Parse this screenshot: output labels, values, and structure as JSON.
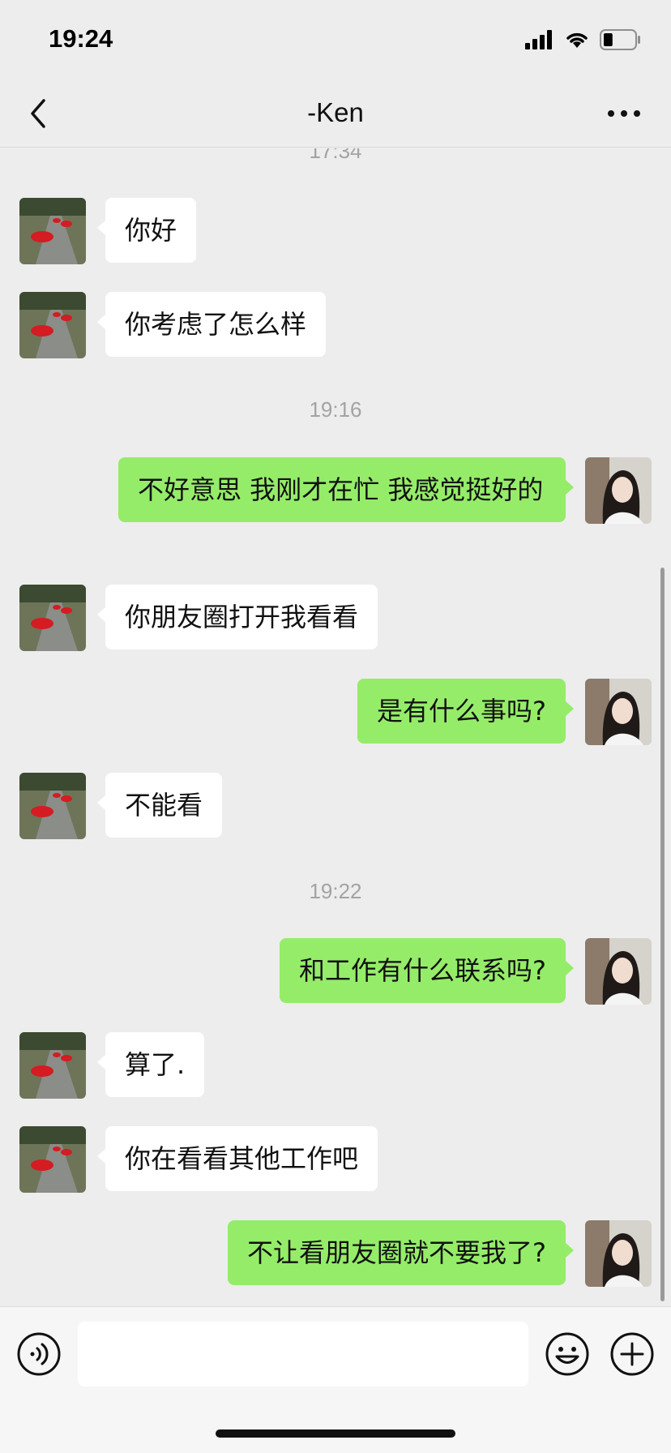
{
  "status_bar": {
    "time": "19:24",
    "battery_level": 0.3
  },
  "header": {
    "title": "-Ken"
  },
  "timestamps": [
    "17:34",
    "19:16",
    "19:22"
  ],
  "messages": [
    {
      "from": "contact",
      "text": "你好"
    },
    {
      "from": "contact",
      "text": "你考虑了怎么样"
    },
    {
      "from": "me",
      "text": "不好意思 我刚才在忙 我感觉挺好的"
    },
    {
      "from": "contact",
      "text": "你朋友圈打开我看看"
    },
    {
      "from": "me",
      "text": "是有什么事吗?"
    },
    {
      "from": "contact",
      "text": "不能看"
    },
    {
      "from": "me",
      "text": "和工作有什么联系吗?"
    },
    {
      "from": "contact",
      "text": "算了."
    },
    {
      "from": "contact",
      "text": "你在看看其他工作吧"
    },
    {
      "from": "me",
      "text": "不让看朋友圈就不要我了?"
    }
  ],
  "colors": {
    "background": "#ededed",
    "incoming_bubble": "#ffffff",
    "outgoing_bubble": "#95ec69",
    "timestamp_text": "#a3a3a3"
  },
  "icons": {
    "back": "chevron-left-icon",
    "more": "more-dots-icon",
    "voice": "voice-icon",
    "emoji": "emoji-icon",
    "plus": "plus-icon",
    "signal": "signal-icon",
    "wifi": "wifi-icon",
    "battery": "battery-icon"
  }
}
